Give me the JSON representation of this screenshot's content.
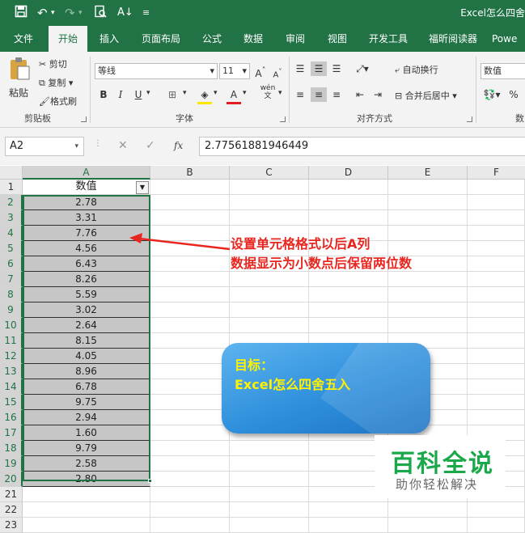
{
  "title_bar": {
    "doc_title": "Excel怎么四舍"
  },
  "tabs": [
    "文件",
    "开始",
    "插入",
    "页面布局",
    "公式",
    "数据",
    "审阅",
    "视图",
    "开发工具",
    "福昕阅读器",
    "Powe"
  ],
  "ribbon": {
    "clipboard": {
      "paste": "粘贴",
      "cut": "剪切",
      "copy": "复制",
      "format_painter": "格式刷",
      "label": "剪贴板"
    },
    "font": {
      "name": "等线",
      "size": "11",
      "bold": "B",
      "italic": "I",
      "underline": "U",
      "label": "字体",
      "font_color_glyph": "A",
      "phonetic": "wén"
    },
    "alignment": {
      "wrap": "自动换行",
      "merge": "合并后居中",
      "label": "对齐方式"
    },
    "number": {
      "format": "数值",
      "percent": "%",
      "label": "数"
    }
  },
  "formula_bar": {
    "name_box": "A2",
    "fx": "fx",
    "value": "2.77561881946449"
  },
  "columns": [
    "A",
    "B",
    "C",
    "D",
    "E",
    "F"
  ],
  "rows": [
    "1",
    "2",
    "3",
    "4",
    "5",
    "6",
    "7",
    "8",
    "9",
    "10",
    "11",
    "12",
    "13",
    "14",
    "15",
    "16",
    "17",
    "18",
    "19",
    "20",
    "21",
    "22",
    "23"
  ],
  "column_a": {
    "header": "数值",
    "values": [
      "2.78",
      "3.31",
      "7.76",
      "4.56",
      "6.43",
      "8.26",
      "5.59",
      "3.02",
      "2.64",
      "8.15",
      "4.05",
      "8.96",
      "6.78",
      "9.75",
      "2.94",
      "1.60",
      "9.79",
      "2.58",
      "2.80"
    ]
  },
  "annotation": {
    "line1": "设置单元格格式以后A列",
    "line2": "数据显示为小数点后保留两位数",
    "color": "#e8261f"
  },
  "goal_box": {
    "line1": "目标：",
    "line2": "Excel怎么四舍五入"
  },
  "watermark": {
    "title": "百科全说",
    "subtitle": "助你轻松解决"
  }
}
